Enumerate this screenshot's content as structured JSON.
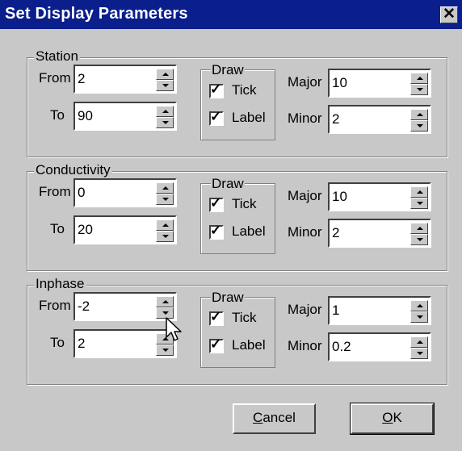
{
  "window": {
    "title": "Set Display Parameters",
    "close_label": "✕"
  },
  "groups": [
    {
      "title": "Station",
      "from_label": "From",
      "from_value": "2",
      "to_label": "To",
      "to_value": "90",
      "draw_label": "Draw",
      "tick_label": "Tick",
      "tick_checked": true,
      "label_label": "Label",
      "label_checked": true,
      "major_label": "Major",
      "major_value": "10",
      "minor_label": "Minor",
      "minor_value": "2"
    },
    {
      "title": "Conductivity",
      "from_label": "From",
      "from_value": "0",
      "to_label": "To",
      "to_value": "20",
      "draw_label": "Draw",
      "tick_label": "Tick",
      "tick_checked": true,
      "label_label": "Label",
      "label_checked": true,
      "major_label": "Major",
      "major_value": "10",
      "minor_label": "Minor",
      "minor_value": "2"
    },
    {
      "title": "Inphase",
      "from_label": "From",
      "from_value": "-2",
      "to_label": "To",
      "to_value": "2",
      "draw_label": "Draw",
      "tick_label": "Tick",
      "tick_checked": true,
      "label_label": "Label",
      "label_checked": true,
      "major_label": "Major",
      "major_value": "1",
      "minor_label": "Minor",
      "minor_value": "0.2"
    }
  ],
  "buttons": {
    "cancel_label": "Cancel",
    "ok_label": "OK"
  },
  "colors": {
    "titlebar": "#0a1e8c",
    "face": "#c8c8c8"
  }
}
